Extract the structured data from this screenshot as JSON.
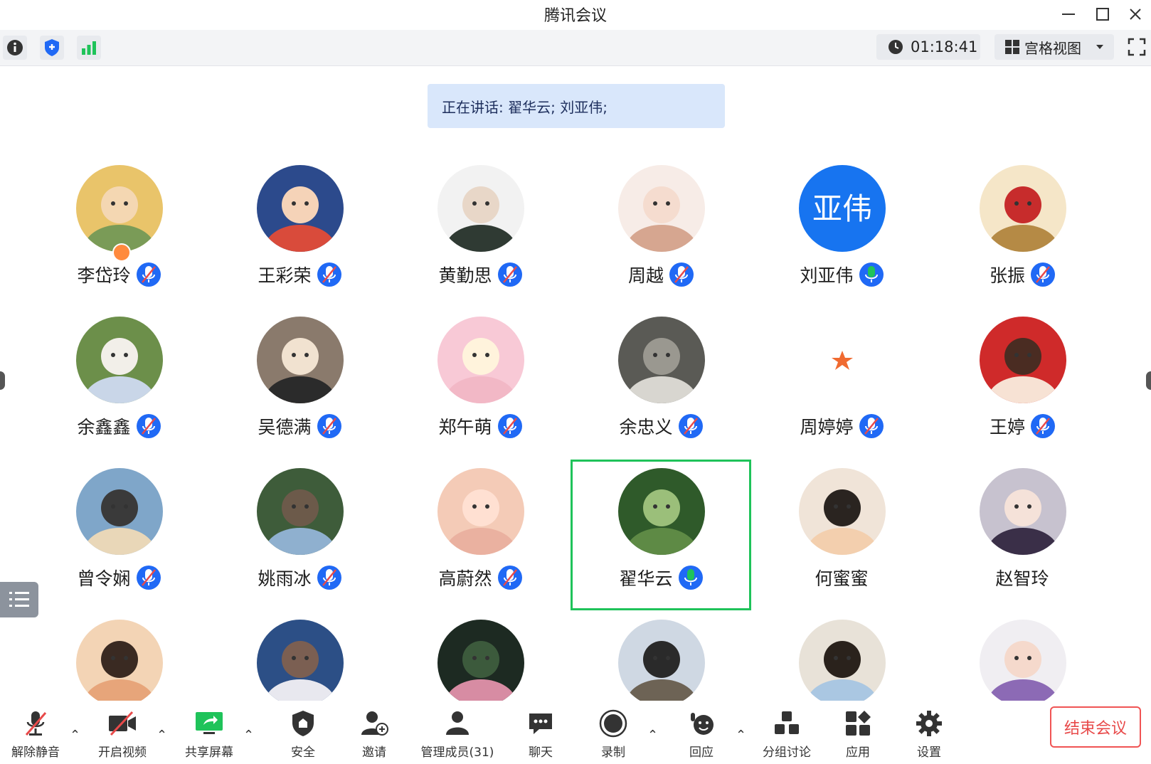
{
  "window": {
    "title": "腾讯会议"
  },
  "toolbar": {
    "timer": "01:18:41",
    "view_label": "宫格视图"
  },
  "speaking": {
    "text": "正在讲话: 翟华云; 刘亚伟;"
  },
  "participants": [
    {
      "name": "李岱玲",
      "mic": "muted",
      "host": true,
      "avatar": "meadow-girl"
    },
    {
      "name": "王彩荣",
      "mic": "muted",
      "avatar": "lion-dance-kid"
    },
    {
      "name": "黄勤思",
      "mic": "muted",
      "avatar": "anime-glasses"
    },
    {
      "name": "周越",
      "mic": "muted",
      "avatar": "anime-girl"
    },
    {
      "name": "刘亚伟",
      "mic": "speaking",
      "avatar_text": "亚伟",
      "avatar_color": "#1774f0"
    },
    {
      "name": "张振",
      "mic": "muted",
      "avatar": "teddy-bear"
    },
    {
      "name": "余鑫鑫",
      "mic": "muted",
      "avatar": "girl-with-dog"
    },
    {
      "name": "吴德满",
      "mic": "muted",
      "avatar": "cartoon-boy"
    },
    {
      "name": "郑午萌",
      "mic": "muted",
      "avatar": "pink-cartoon"
    },
    {
      "name": "余忠义",
      "mic": "muted",
      "avatar": "white-animal"
    },
    {
      "name": "周婷婷",
      "mic": "muted",
      "avatar": "star"
    },
    {
      "name": "王婷",
      "mic": "muted",
      "avatar": "red-cartoon-girl"
    },
    {
      "name": "曾令娴",
      "mic": "muted",
      "avatar": "sky-frame"
    },
    {
      "name": "姚雨冰",
      "mic": "muted",
      "avatar": "street"
    },
    {
      "name": "高蔚然",
      "mic": "muted",
      "avatar": "piggy"
    },
    {
      "name": "翟华云",
      "mic": "speaking",
      "active": true,
      "avatar": "green-leaves"
    },
    {
      "name": "何蜜蜜",
      "mic": "none",
      "avatar": "child"
    },
    {
      "name": "赵智玲",
      "mic": "none",
      "avatar": "anime-dark-hair"
    },
    {
      "name": "",
      "avatar": "baby"
    },
    {
      "name": "",
      "avatar": "mountain"
    },
    {
      "name": "",
      "avatar": "flowers"
    },
    {
      "name": "",
      "avatar": "pagoda"
    },
    {
      "name": "",
      "avatar": "young-man"
    },
    {
      "name": "",
      "avatar": "purple-hair"
    }
  ],
  "bottom": {
    "unmute": "解除静音",
    "video": "开启视频",
    "share": "共享屏幕",
    "security": "安全",
    "invite": "邀请",
    "members": "管理成员(31)",
    "chat": "聊天",
    "record": "录制",
    "react": "回应",
    "breakout": "分组讨论",
    "apps": "应用",
    "settings": "设置",
    "end": "结束会议"
  },
  "colors": {
    "accent": "#2069f5",
    "speaking": "#1fc35a",
    "danger": "#e84a4a"
  }
}
